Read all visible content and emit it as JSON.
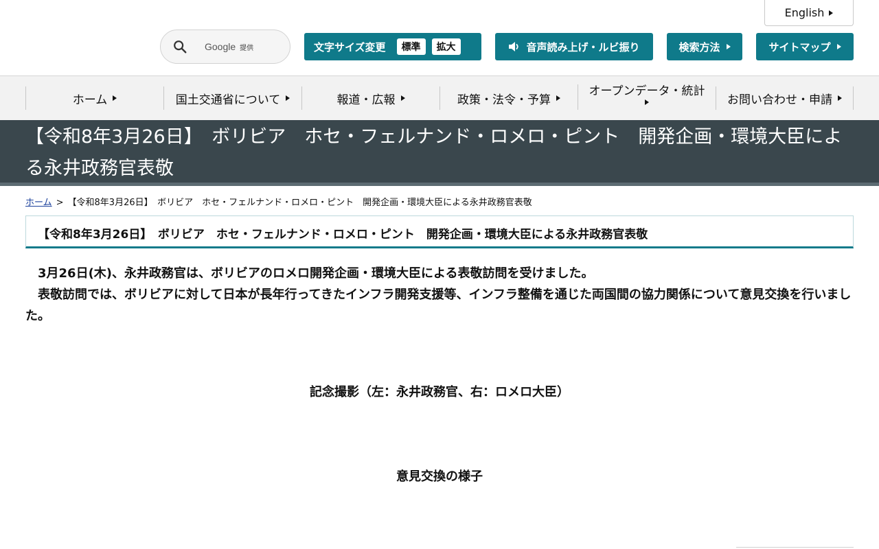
{
  "header": {
    "language_label": "English",
    "search": {
      "brand": "Google",
      "provided": "提供"
    },
    "fontsize": {
      "label": "文字サイズ変更",
      "standard": "標準",
      "large": "拡大"
    },
    "speech_label": "音声読み上げ・ルビ振り",
    "search_help_label": "検索方法",
    "sitemap_label": "サイトマップ"
  },
  "nav": {
    "items": [
      {
        "label": "ホーム"
      },
      {
        "label": "国土交通省について"
      },
      {
        "label": "報道・広報"
      },
      {
        "label": "政策・法令・予算"
      },
      {
        "label": "オープンデータ・統計"
      },
      {
        "label": "お問い合わせ・申請"
      }
    ]
  },
  "banner": {
    "title": "【令和8年3月26日】　ボリビア　ホセ・フェルナンド・ロメロ・ピント　開発企画・環境大臣による永井政務官表敬"
  },
  "breadcrumb": {
    "home": "ホーム",
    "separator": ">",
    "current": "【令和8年3月26日】　ボリビア　ホセ・フェルナンド・ロメロ・ピント　開発企画・環境大臣による永井政務官表敬"
  },
  "article": {
    "heading": "【令和8年3月26日】　ボリビア　ホセ・フェルナンド・ロメロ・ピント　開発企画・環境大臣による永井政務官表敬",
    "paragraphs": [
      "3月26日(木)、永井政務官は、ボリビアのロメロ開発企画・環境大臣による表敬訪問を受けました。",
      "表敬訪問では、ボリビアに対して日本が長年行ってきたインフラ開発支援等、インフラ整備を通じた両国間の協力関係について意見交換を行いました。"
    ],
    "captions": [
      "記念撮影（左：永井政務官、右：ロメロ大臣）",
      "意見交換の様子"
    ]
  },
  "colors": {
    "accent": "#0f7a8a",
    "banner_bg": "#3a474d",
    "nav_bg": "#f2f2f2",
    "link": "#1a3f9b"
  },
  "icons": [
    "search-icon",
    "speaker-icon",
    "triangle-right-icon"
  ]
}
